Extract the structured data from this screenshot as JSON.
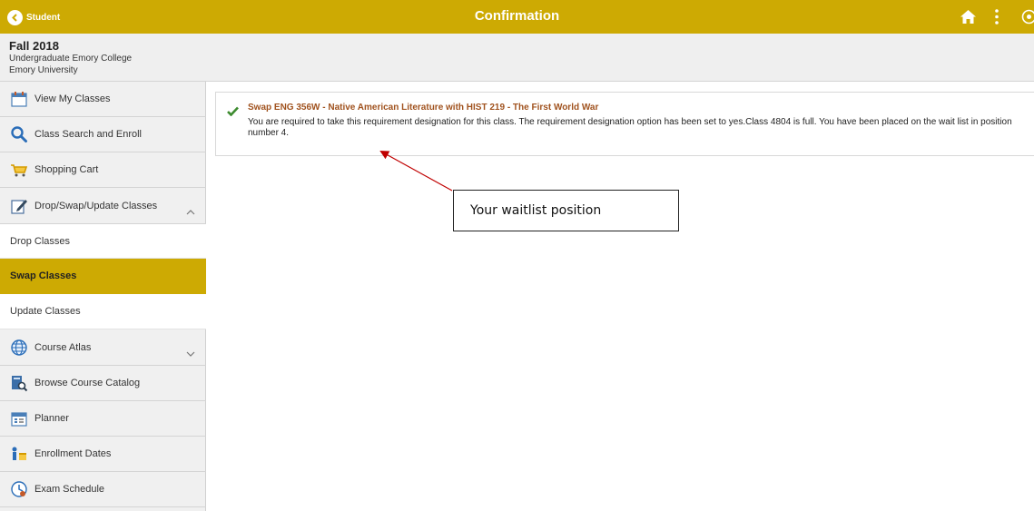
{
  "header": {
    "back_label": "Student",
    "title": "Confirmation",
    "accent_color": "#cdaa03",
    "icons": [
      "chevron-left-icon",
      "home-icon",
      "kebab-menu-icon",
      "navbar-icon"
    ]
  },
  "term": {
    "title": "Fall 2018",
    "career": "Undergraduate Emory College",
    "institution": "Emory University"
  },
  "sidebar": {
    "items": [
      {
        "label": "View My Classes",
        "icon": "calendar-icon"
      },
      {
        "label": "Class Search and Enroll",
        "icon": "search-icon"
      },
      {
        "label": "Shopping Cart",
        "icon": "cart-icon"
      },
      {
        "label": "Drop/Swap/Update Classes",
        "icon": "edit-icon",
        "expanded": true,
        "children": [
          "Drop Classes",
          "Swap Classes",
          "Update Classes"
        ],
        "selected": "Swap Classes"
      },
      {
        "label": "Course Atlas",
        "icon": "globe-icon",
        "expanded": false
      },
      {
        "label": "Browse Course Catalog",
        "icon": "catalog-icon"
      },
      {
        "label": "Planner",
        "icon": "planner-icon"
      },
      {
        "label": "Enrollment Dates",
        "icon": "enrollment-dates-icon"
      },
      {
        "label": "Exam Schedule",
        "icon": "exam-schedule-icon"
      }
    ]
  },
  "message": {
    "status": "success",
    "status_color": "#3d8b2f",
    "title": "Swap ENG  356W - Native American Literature with HIST  219 - The First World War",
    "body": "You are required to take this requirement designation for this class. The requirement designation option has been set to yes.Class 4804 is full. You have been placed on the wait list in position number 4."
  },
  "annotation": {
    "text": "Your waitlist position",
    "arrow_color": "#c00000"
  }
}
